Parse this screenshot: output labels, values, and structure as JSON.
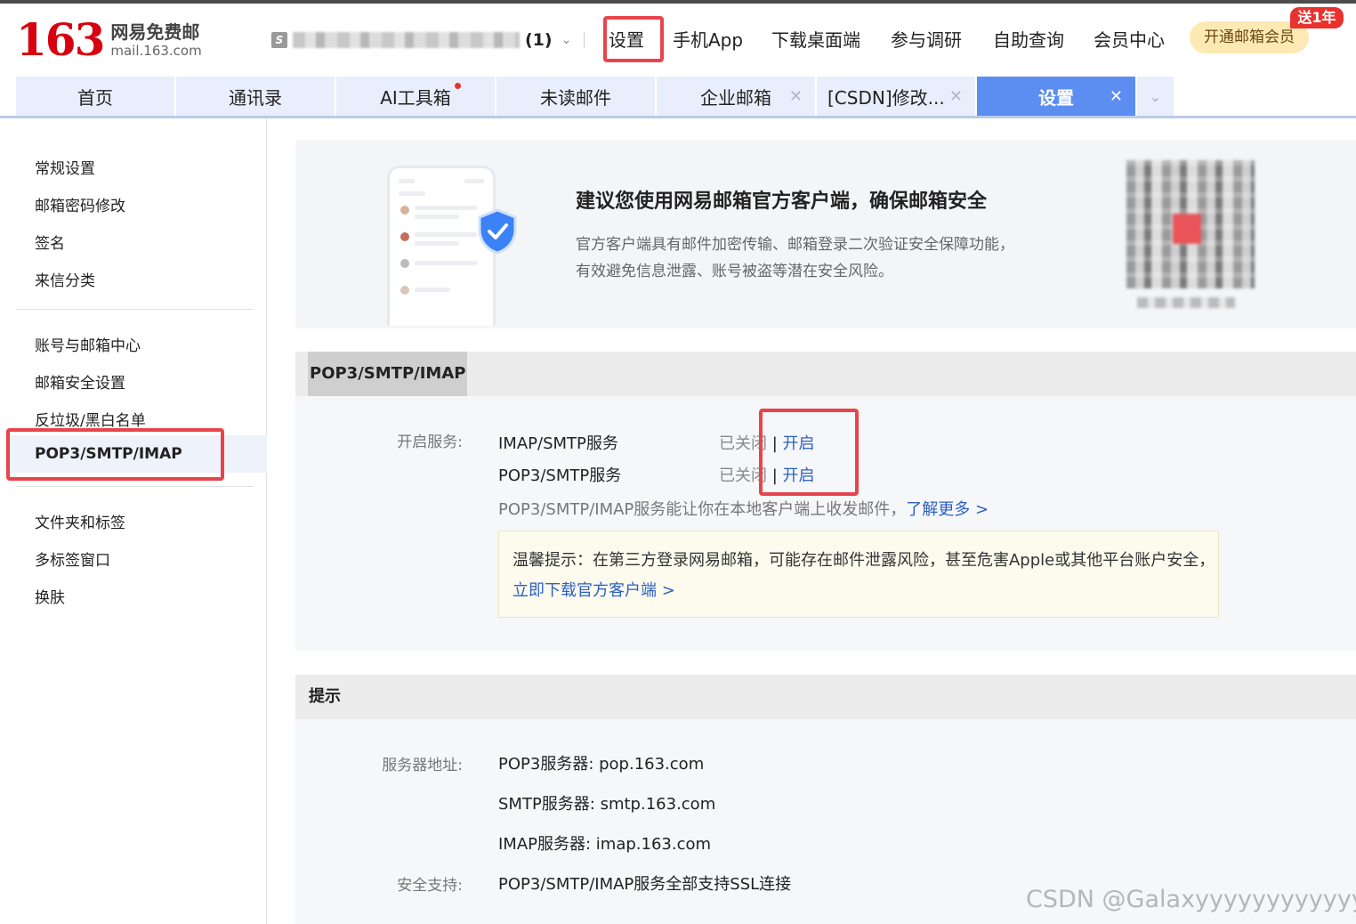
{
  "header": {
    "logo_number": "163",
    "logo_cn": "网易免费邮",
    "logo_domain": "mail.163.com",
    "account_unread": "(1)",
    "nav": [
      "设置",
      "手机App",
      "下载桌面端",
      "参与调研",
      "自助查询",
      "会员中心"
    ],
    "vip_button": "开通邮箱会员",
    "vip_badge": "送1年"
  },
  "tabs": [
    {
      "label": "首页"
    },
    {
      "label": "通讯录"
    },
    {
      "label": "AI工具箱"
    },
    {
      "label": "未读邮件"
    },
    {
      "label": "企业邮箱"
    },
    {
      "label": "[CSDN]修改..."
    },
    {
      "label": "设置"
    }
  ],
  "sidebar": {
    "group1": [
      "常规设置",
      "邮箱密码修改",
      "签名",
      "来信分类"
    ],
    "group2": [
      "账号与邮箱中心",
      "邮箱安全设置",
      "反垃圾/黑白名单",
      "POP3/SMTP/IMAP"
    ],
    "group3": [
      "文件夹和标签",
      "多标签窗口",
      "换肤"
    ]
  },
  "banner": {
    "title": "建议您使用网易邮箱官方客户端，确保邮箱安全",
    "desc": "官方客户端具有邮件加密传输、邮箱登录二次验证安全保障功能，有效避免信息泄露、账号被盗等潜在安全风险。"
  },
  "pop_section": {
    "title": "POP3/SMTP/IMAP",
    "open_service_label": "开启服务:",
    "services": [
      {
        "name": "IMAP/SMTP服务",
        "status": "已关闭",
        "sep": "|",
        "action": "开启"
      },
      {
        "name": "POP3/SMTP服务",
        "status": "已关闭",
        "sep": "|",
        "action": "开启"
      }
    ],
    "note": "POP3/SMTP/IMAP服务能让你在本地客户端上收发邮件，",
    "learn_more": "了解更多 >",
    "tip": "温馨提示：在第三方登录网易邮箱，可能存在邮件泄露风险，甚至危害Apple或其他平台账户安全，",
    "tip_link": "立即下载官方客户端 >"
  },
  "hint_section": {
    "title": "提示",
    "server_label": "服务器地址:",
    "servers": [
      "POP3服务器: pop.163.com",
      "SMTP服务器: smtp.163.com",
      "IMAP服务器: imap.163.com"
    ],
    "ssl_label": "安全支持:",
    "ssl_value": "POP3/SMTP/IMAP服务全部支持SSL连接"
  },
  "watermark": "CSDN @Galaxyyyyyyyyyyyyy"
}
